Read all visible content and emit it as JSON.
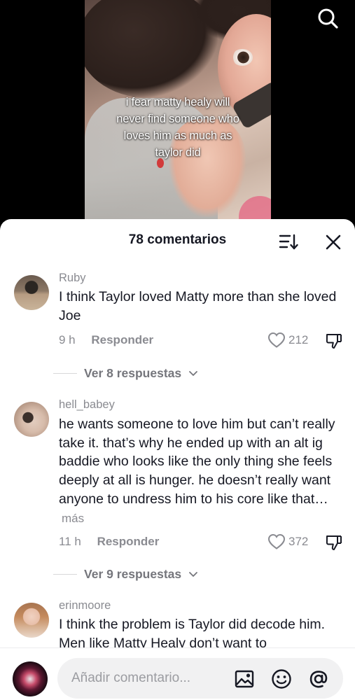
{
  "video": {
    "caption_lines": [
      "i fear matty healy will",
      "never find someone who",
      "loves him as much as",
      "taylor did"
    ]
  },
  "sheet": {
    "title": "78 comentarios"
  },
  "comments": [
    {
      "username": "Ruby",
      "text": "I think Taylor loved Matty more than she loved Joe",
      "time": "9 h",
      "reply_label": "Responder",
      "likes": "212",
      "view_replies": "Ver 8 respuestas"
    },
    {
      "username": "hell_babey",
      "text": "he wants someone to love him but can’t really take it. that’s why he ended up with an alt ig baddie who looks like the only thing she feels deeply at all is hunger. he doesn’t really want anyone to undress him to his core like that…",
      "more_label": "más",
      "time": "11 h",
      "reply_label": "Responder",
      "likes": "372",
      "view_replies": "Ver 9 respuestas"
    },
    {
      "username": "erinmoore",
      "text": "I think the problem is Taylor did decode him. Men like Matty Healy don’t want to"
    }
  ],
  "composer": {
    "placeholder": "Añadir comentario..."
  },
  "icons": {
    "search": "search-icon",
    "sort": "sort-icon",
    "close": "close-icon",
    "like": "heart-icon",
    "dislike": "thumbs-down-icon",
    "chevron": "chevron-down-icon",
    "image": "image-icon",
    "emoji": "emoji-icon",
    "mention": "at-mention-icon"
  },
  "colors": {
    "text_primary": "#161823",
    "text_secondary": "#8a8b91",
    "sheet_bg": "#ffffff",
    "input_bg": "#f1f1f2"
  }
}
